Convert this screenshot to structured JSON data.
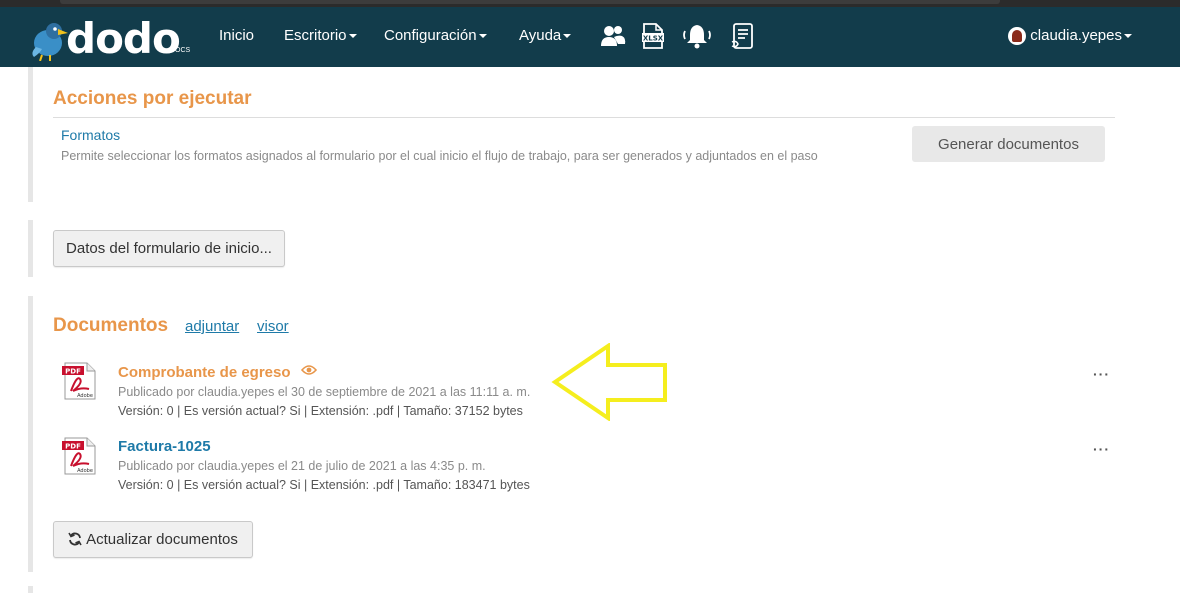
{
  "navbar": {
    "logo_text": "dodo",
    "logo_sub": "DOCS",
    "items": [
      {
        "label": "Inicio",
        "dropdown": false
      },
      {
        "label": "Escritorio",
        "dropdown": true
      },
      {
        "label": "Configuración",
        "dropdown": true
      },
      {
        "label": "Ayuda",
        "dropdown": true
      }
    ],
    "icons": [
      "users-icon",
      "xlsx-file-icon",
      "bell-icon",
      "document-list-icon"
    ],
    "user": "claudia.yepes"
  },
  "actions": {
    "title": "Acciones por ejecutar",
    "item_label": "Formatos",
    "item_description": "Permite seleccionar los formatos asignados al formulario por el cual inicio el flujo de trabajo, para ser generados y adjuntados en el paso",
    "generate_button": "Generar documentos"
  },
  "form_button": "Datos del formulario de inicio...",
  "documents": {
    "title": "Documentos",
    "attach_link": "adjuntar",
    "viewer_link": "visor",
    "items": [
      {
        "name": "Comprobante de egreso",
        "name_color": "#e8964a",
        "published": "Publicado por claudia.yepes el 30 de septiembre de 2021 a las 11:11 a. m.",
        "meta": "Versión: 0 | Es versión actual? Si | Extensión: .pdf | Tamaño: 37152 bytes",
        "has_eye": true
      },
      {
        "name": "Factura-1025",
        "name_color": "#1e7aa8",
        "published": "Publicado por claudia.yepes el 21 de julio de 2021 a las 4:35 p. m.",
        "meta": "Versión: 0 | Es versión actual? Si | Extensión: .pdf | Tamaño: 183471 bytes",
        "has_eye": false
      }
    ],
    "menu_glyph": "···",
    "refresh_button": "Actualizar documentos"
  },
  "colors": {
    "navbar": "#123c4b",
    "accent_orange": "#e8964a",
    "link_blue": "#1e7aa8",
    "annotation_arrow": "#f5ee1e"
  }
}
